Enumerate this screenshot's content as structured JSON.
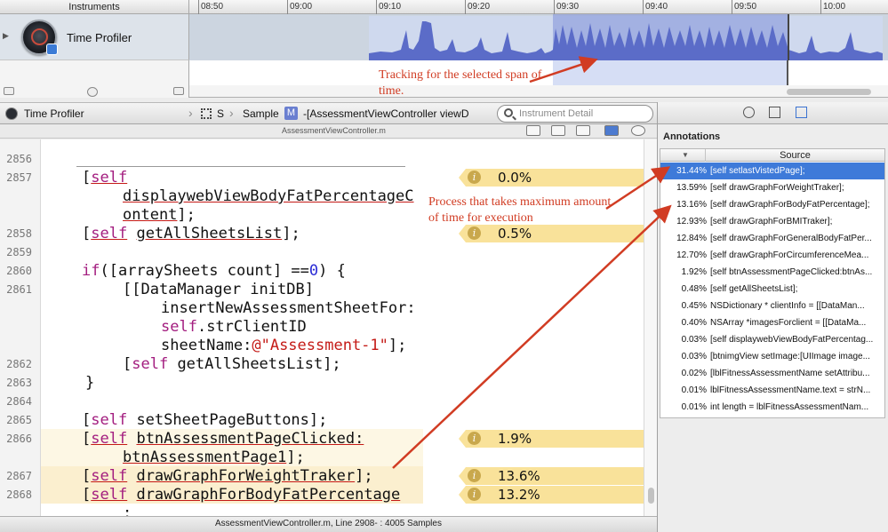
{
  "toolbar": {
    "instruments_label": "Instruments",
    "time_ticks": [
      "08:50",
      "09:00",
      "09:10",
      "09:20",
      "09:30",
      "09:40",
      "09:50",
      "10:00"
    ]
  },
  "instrument": {
    "name": "Time Profiler"
  },
  "jumpbar": {
    "item1": "Time Profiler",
    "item2": "S",
    "item3": "Sample",
    "m_badge": "M",
    "item4": "-[AssessmentViewController viewD",
    "search_placeholder": "Instrument Detail"
  },
  "file_label": "AssessmentViewController.m",
  "code_lines": {
    "n2856": "2856",
    "n2857": "2857",
    "n2858": "2858",
    "n2859": "2859",
    "n2860": "2860",
    "n2861": "2861",
    "n2862": "2862",
    "n2863": "2863",
    "n2864": "2864",
    "n2865": "2865",
    "n2866": "2866",
    "n2867": "2867",
    "n2868": "2868"
  },
  "annotations_inline": {
    "a2857": "0.0%",
    "a2858": "0.5%",
    "a2866": "1.9%",
    "a2867": "13.6%",
    "a2868": "13.2%"
  },
  "status": "AssessmentViewController.m, Line 2908- : 4005 Samples",
  "inspector": {
    "title": "Annotations",
    "column": "Source",
    "rows": [
      {
        "pct": "31.44%",
        "src": "[self setlastVistedPage];"
      },
      {
        "pct": "13.59%",
        "src": "[self drawGraphForWeightTraker];"
      },
      {
        "pct": "13.16%",
        "src": "[self drawGraphForBodyFatPercentage];"
      },
      {
        "pct": "12.93%",
        "src": "[self drawGraphForBMITraker];"
      },
      {
        "pct": "12.84%",
        "src": "[self drawGraphForGeneralBodyFatPer..."
      },
      {
        "pct": "12.70%",
        "src": "[self drawGraphForCircumferenceMea..."
      },
      {
        "pct": "1.92%",
        "src": "[self btnAssessmentPageClicked:btnAs..."
      },
      {
        "pct": "0.48%",
        "src": "[self getAllSheetsList];"
      },
      {
        "pct": "0.45%",
        "src": "NSDictionary * clientInfo = [[DataMan..."
      },
      {
        "pct": "0.40%",
        "src": "NSArray *imagesForclient = [[DataMa..."
      },
      {
        "pct": "0.03%",
        "src": "[self displaywebViewBodyFatPercentag..."
      },
      {
        "pct": "0.03%",
        "src": "[btnimgView setImage:[UIImage image..."
      },
      {
        "pct": "0.02%",
        "src": "[lblFitnessAssessmentName setAttribu..."
      },
      {
        "pct": "0.01%",
        "src": "lblFitnessAssessmentName.text = strN..."
      },
      {
        "pct": "0.01%",
        "src": "int length = lblFitnessAssessmentNam..."
      }
    ]
  },
  "callouts": {
    "tracking_line1": "Tracking for the selected span of",
    "tracking_line2": "time.",
    "process_line1": "Process that takes maximum amount",
    "process_line2": "of time for execution"
  },
  "colors": {
    "selection": "#3e7ad9",
    "annotation_bg": "#f9e29a",
    "callout": "#d13c23",
    "track": "#5b6cc8"
  }
}
